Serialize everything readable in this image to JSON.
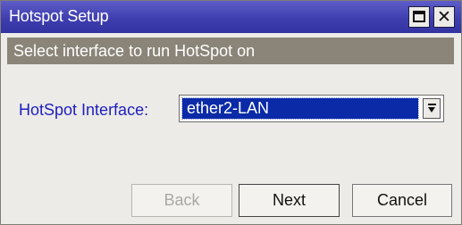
{
  "window": {
    "title": "Hotspot Setup",
    "maximize_icon": "maximize-icon",
    "close_icon": "close-icon",
    "close_glyph": "✕"
  },
  "banner": {
    "text": "Select interface to run HotSpot on"
  },
  "form": {
    "label": "HotSpot Interface:",
    "selected_value": "ether2-LAN",
    "dropdown_icon": "chevron-down-icon"
  },
  "buttons": {
    "back": {
      "label": "Back",
      "enabled": false
    },
    "next": {
      "label": "Next",
      "enabled": true
    },
    "cancel": {
      "label": "Cancel",
      "enabled": true
    }
  },
  "colors": {
    "titlebar": "#3f3eaf",
    "banner": "#8a8578",
    "label": "#1e1ec0",
    "selection": "#0a2aa8"
  }
}
